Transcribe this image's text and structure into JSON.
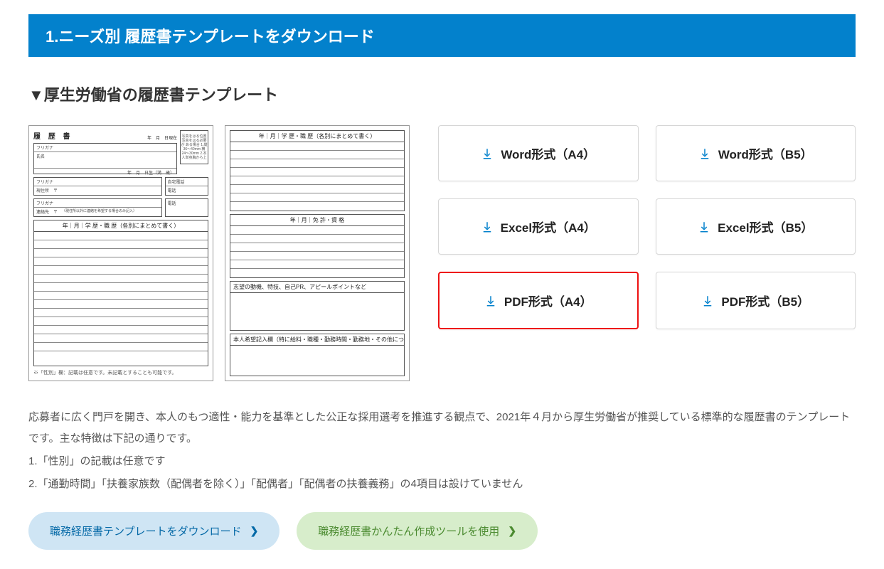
{
  "header": {
    "title": "1.ニーズ別 履歴書テンプレートをダウンロード"
  },
  "subheading": "▼厚生労働省の履歴書テンプレート",
  "preview": {
    "page1": {
      "doc_title": "履 歴 書",
      "date_label": "年　月　日現在",
      "furigana_label": "フリガナ",
      "name_label": "氏名",
      "birth_label": "年　月　日生（満　歳）",
      "address_furigana_label": "フリガナ",
      "address_label": "現住所　〒",
      "contact_furigana_label": "フリガナ",
      "contact_label": "連絡先　〒",
      "contact_note": "（現住所以外に連絡を希望する場合のみ記入）",
      "phone_label1": "自宅電話",
      "phone_label2": "電話",
      "phone_label3": "電話",
      "photo_note": "写真をはる位置\n写真をはる必要が\nある場合\n1.縦36〜40mm\n横24〜30mm\n2.本人単身胸から上",
      "table_header": "年｜月｜学 歴・職 歴（各別にまとめて書く）",
      "footnote": "※「性別」欄：記載は任意です。未記載とすることも可能です。"
    },
    "page2": {
      "table_header": "年｜月｜学 歴・職 歴（各別にまとめて書く）",
      "license_header": "年｜月｜免 許・資 格",
      "appeal_header": "志望の動機、特技、自己PR、アピールポイントなど",
      "wish_header": "本人希望記入欄（特に給料・職種・勤務時間・勤務地・その他についての希望などがあれば記入）"
    }
  },
  "downloads": [
    {
      "label": "Word形式（A4）",
      "highlighted": false
    },
    {
      "label": "Word形式（B5）",
      "highlighted": false
    },
    {
      "label": "Excel形式（A4）",
      "highlighted": false
    },
    {
      "label": "Excel形式（B5）",
      "highlighted": false
    },
    {
      "label": "PDF形式（A4）",
      "highlighted": true
    },
    {
      "label": "PDF形式（B5）",
      "highlighted": false
    }
  ],
  "description": {
    "p1": "応募者に広く門戸を開き、本人のもつ適性・能力を基準とした公正な採用選考を推進する観点で、2021年４月から厚生労働省が推奨している標準的な履歴書のテンプレートです。主な特徴は下記の通りです。",
    "li1": "1.「性別」の記載は任意です",
    "li2": "2.「通勤時間」「扶養家族数（配偶者を除く）」「配偶者」「配偶者の扶養義務」の4項目は設けていません"
  },
  "ctas": {
    "dl_templates": "職務経歴書テンプレートをダウンロード",
    "easy_tool": "職務経歴書かんたん作成ツールを使用"
  }
}
